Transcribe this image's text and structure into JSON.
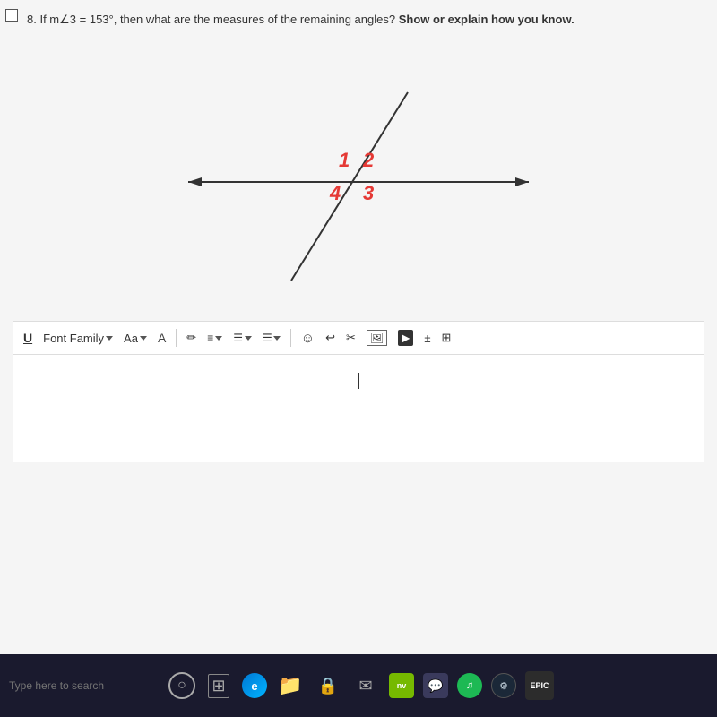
{
  "question": {
    "number": "8.",
    "text": "If m∠3 = 153°, then what are the measures of the remaining angles?",
    "bold_text": "Show or explain how you know.",
    "angle_labels": {
      "label1": "1",
      "label2": "2",
      "label3": "3",
      "label4": "4"
    }
  },
  "toolbar": {
    "underline_label": "U",
    "font_family_label": "Font Family",
    "font_size_label": "Aa",
    "symbols": [
      "▲",
      "✏",
      "≡",
      "☰",
      "☺",
      "↩",
      "✂",
      "🖼",
      "▶",
      "±",
      "⊞"
    ],
    "dropdown_arrow": "▾"
  },
  "taskbar": {
    "search_placeholder": "Type here to search",
    "icons": [
      "⊙",
      "edge",
      "📁",
      "🔒",
      "📧",
      "nvidia",
      "💬",
      "spotify",
      "steam",
      "epic"
    ]
  },
  "colors": {
    "accent_red": "#e53935",
    "line_black": "#333333",
    "toolbar_bg": "#ffffff",
    "main_bg": "#f5f5f5"
  }
}
